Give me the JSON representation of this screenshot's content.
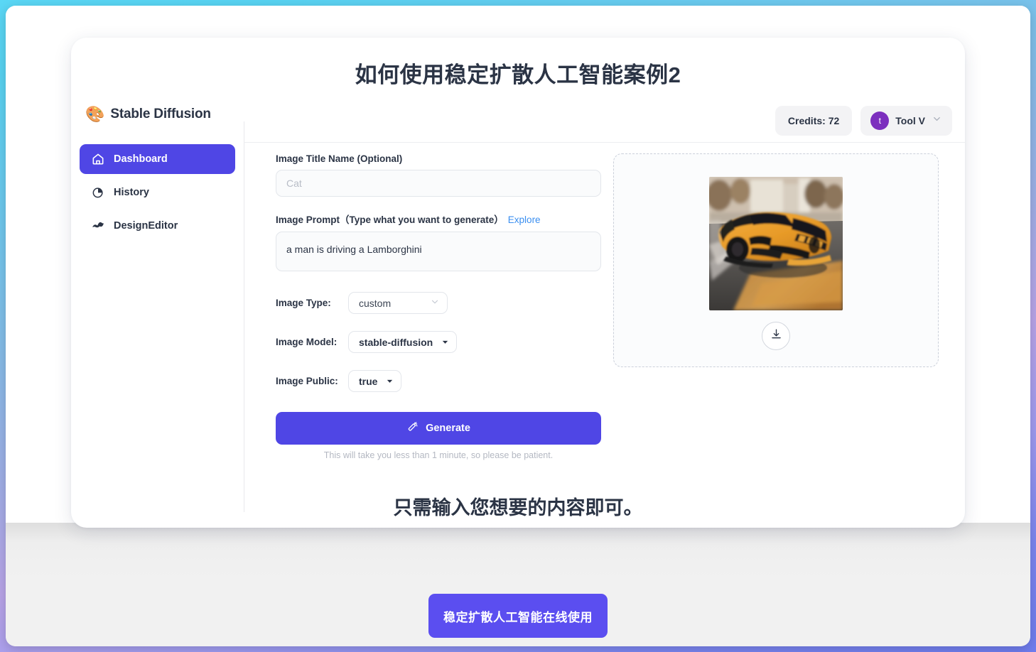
{
  "document": {
    "title": "如何使用稳定扩散人工智能案例2",
    "caption": "只需输入您想要的内容即可。",
    "cta_label": "稳定扩散人工智能在线使用"
  },
  "sidebar": {
    "brand": {
      "emoji": "🎨",
      "name": "Stable Diffusion"
    },
    "items": [
      {
        "label": "Dashboard",
        "icon": "home-icon",
        "active": true
      },
      {
        "label": "History",
        "icon": "pie-chart-icon",
        "active": false
      },
      {
        "label": "DesignEditor",
        "icon": "design-editor-icon",
        "active": false
      }
    ]
  },
  "topbar": {
    "credits_label": "Credits: 72",
    "user": {
      "avatar_initial": "t",
      "name": "Tool V"
    }
  },
  "form": {
    "title_field": {
      "label": "Image Title Name (Optional)",
      "value": "",
      "placeholder": "Cat"
    },
    "prompt_field": {
      "label": "Image Prompt（Type what you want to generate）",
      "explore_link": "Explore",
      "value": "a man is driving a Lamborghini",
      "placeholder": ""
    },
    "image_type": {
      "label": "Image Type:",
      "value": "custom"
    },
    "image_model": {
      "label": "Image Model:",
      "value": "stable-diffusion"
    },
    "image_public": {
      "label": "Image Public:",
      "value": "true"
    },
    "generate": {
      "label": "Generate",
      "hint": "This will take you less than 1 minute, so please be patient."
    }
  },
  "preview": {
    "image_alt": "a man is driving a Lamborghini",
    "download_icon": "download-icon"
  },
  "colors": {
    "accent": "#4f46e5",
    "cta": "#5b4ef0",
    "link": "#3b8ff0",
    "avatar": "#7c2fbe",
    "text": "#2b3445",
    "muted": "#b4b8c2"
  }
}
